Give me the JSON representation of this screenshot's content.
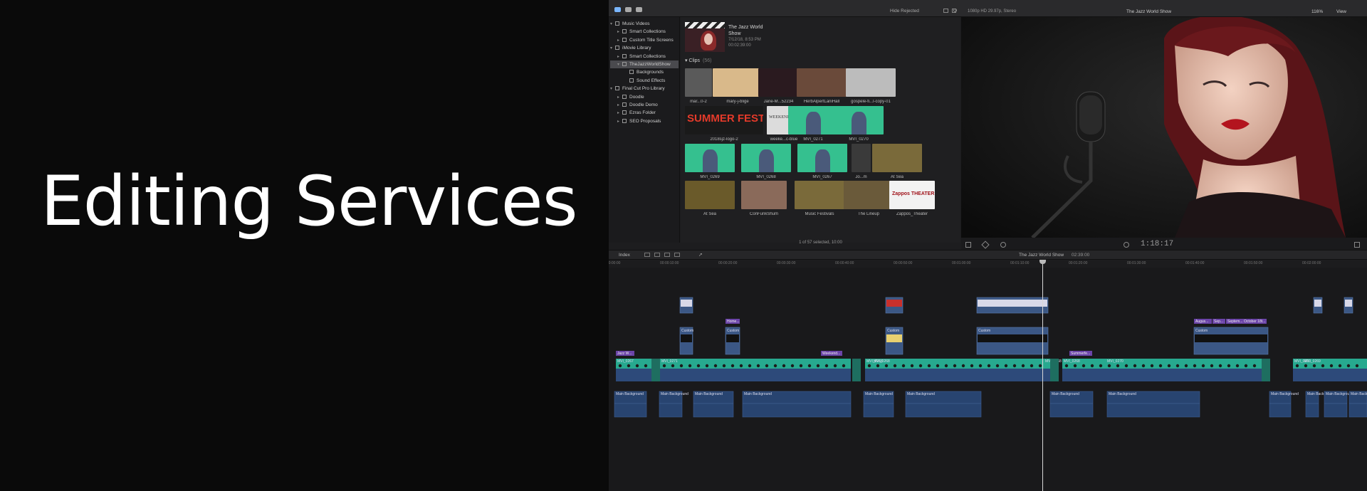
{
  "hero": {
    "title": "Editing Services"
  },
  "toolbar": {
    "filter": "Hide Rejected",
    "viewer_format": "1080p HD 29.97p, Stereo",
    "viewer_title": "The Jazz World Show",
    "zoom": "116%",
    "view": "View"
  },
  "sidebar": {
    "items": [
      {
        "label": "Music Videos",
        "indent": 0,
        "selected": false
      },
      {
        "label": "Smart Collections",
        "indent": 1,
        "selected": false
      },
      {
        "label": "Custom Title Screens",
        "indent": 1,
        "selected": false
      },
      {
        "label": "iMovie Library",
        "indent": 0,
        "selected": false
      },
      {
        "label": "Smart Collections",
        "indent": 1,
        "selected": false
      },
      {
        "label": "TheJazzWorldShow",
        "indent": 1,
        "selected": true
      },
      {
        "label": "Backgrounds",
        "indent": 2,
        "selected": false
      },
      {
        "label": "Sound Effects",
        "indent": 2,
        "selected": false
      },
      {
        "label": "Final Cut Pro Library",
        "indent": 0,
        "selected": false
      },
      {
        "label": "Doodle",
        "indent": 1,
        "selected": false
      },
      {
        "label": "Doodle Demo",
        "indent": 1,
        "selected": false
      },
      {
        "label": "Ezras Folder",
        "indent": 1,
        "selected": false
      },
      {
        "label": "SEO Proposals",
        "indent": 1,
        "selected": false
      }
    ]
  },
  "event": {
    "title": "The Jazz World Show",
    "date": "7/12/18, 8:53 PM",
    "duration": "00:02:39:00"
  },
  "clips": {
    "heading": "Clips",
    "count": "(56)",
    "items": [
      {
        "label": "mar...0-2",
        "color": "#5a5a5a"
      },
      {
        "label": "mary-j-blige",
        "color": "#d9b98a"
      },
      {
        "label": "Jane-M...52234",
        "color": "#2a1a1f"
      },
      {
        "label": "HerbAlpertLaniHall",
        "color": "#6a4a3a"
      },
      {
        "label": "gospele-fi...l-copy-01",
        "color": "#bcbcbc"
      },
      {
        "label": "2018sjz-logo-2",
        "color": "#1a1a1a"
      },
      {
        "label": "weeke...c-blue",
        "color": "#dcdcdc"
      },
      {
        "label": "MVI_0271",
        "color": "#35c08f"
      },
      {
        "label": "MVI_0270",
        "color": "#35c08f"
      },
      {
        "label": "MVI_0269",
        "color": "#35c08f"
      },
      {
        "label": "MVI_0268",
        "color": "#35c08f"
      },
      {
        "label": "MVI_0267",
        "color": "#35c08f"
      },
      {
        "label": "Jo...m",
        "color": "#3a3a3a"
      },
      {
        "label": "At Sea",
        "color": "#7a6a3a"
      },
      {
        "label": "At Sea",
        "color": "#6a5a2a"
      },
      {
        "label": "ConFunkShum",
        "color": "#8a6a5a"
      },
      {
        "label": "Music Festivals",
        "color": "#7a6a3a"
      },
      {
        "label": "The Lineup",
        "color": "#6a5a3a"
      },
      {
        "label": "Zappos_Theater",
        "color": "#f2f2f2"
      }
    ],
    "logo_text": "SUMMER FEST",
    "zappos_text": "Zappos THEATER",
    "weekend_text": "WEEKEND JAZZ",
    "status": "1 of 57 selected, 10:00"
  },
  "viewer": {
    "timecode": "1:18:17"
  },
  "timeline": {
    "index_label": "Index",
    "title": "The Jazz World Show",
    "duration": "02:39:00",
    "ruler": [
      "00:00:00:00",
      "00:00:10:00",
      "00:00:20:00",
      "00:00:30:00",
      "00:00:40:00",
      "00:00:50:00",
      "00:01:00:00",
      "00:01:10:00",
      "00:01:20:00",
      "00:01:30:00",
      "00:01:40:00",
      "00:01:50:00",
      "00:02:00:00"
    ],
    "primary_labels": [
      "MVI_0267",
      "MVI_0271",
      "MVI_0268",
      "MVI_0268",
      "MVI_0270",
      "MVI_0269"
    ],
    "title_labels": [
      "Custom",
      "Custom",
      "Custom",
      "Custom",
      "Custom"
    ],
    "purple_labels": [
      "Jazz W...",
      "Home...",
      "Weekend...",
      "Summerfe...",
      "Augus...",
      "Sep...",
      "Septem...",
      "October 18t..."
    ],
    "audio_label": "Main Background"
  }
}
